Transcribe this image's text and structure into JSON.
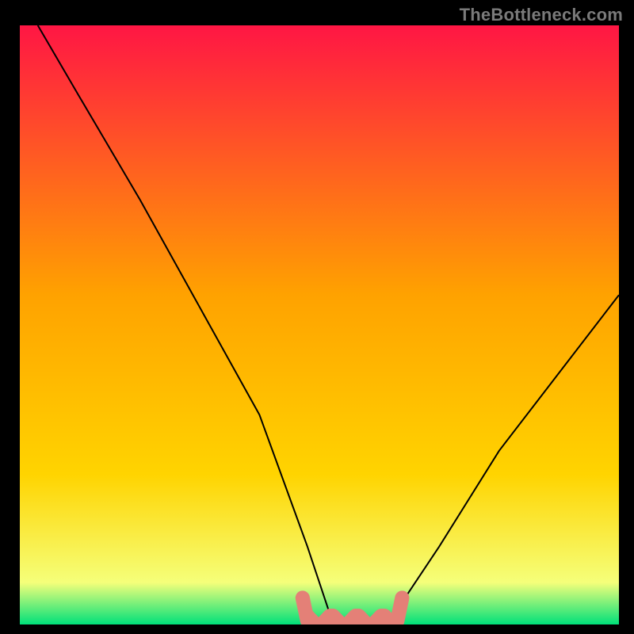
{
  "watermark": "TheBottleneck.com",
  "chart_data": {
    "type": "line",
    "title": "",
    "xlabel": "",
    "ylabel": "",
    "xlim": [
      0,
      100
    ],
    "ylim": [
      0,
      100
    ],
    "background_gradient": {
      "top": "#ff1644",
      "mid": "#ffd400",
      "floor_band": "#f5ff7a",
      "bottom": "#00e07a"
    },
    "curve": {
      "name": "bottleneck-curve",
      "x": [
        3,
        10,
        20,
        30,
        40,
        48,
        52,
        57,
        62,
        70,
        80,
        90,
        100
      ],
      "y": [
        100,
        88,
        71,
        53,
        35,
        13,
        1,
        0.5,
        1,
        13,
        29,
        42,
        55
      ]
    },
    "flat_band": {
      "y": 0.6,
      "x_start": 48,
      "x_end": 63,
      "color": "#e48077",
      "thickness": 2.4
    }
  }
}
